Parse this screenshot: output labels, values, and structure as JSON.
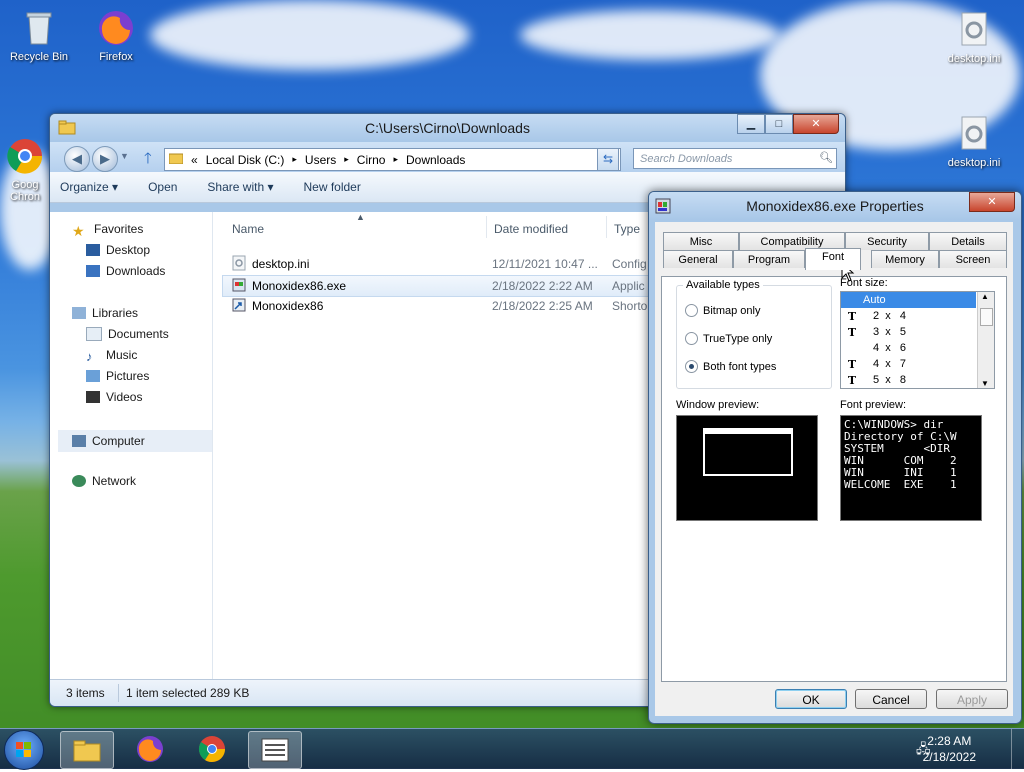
{
  "desktop": {
    "icons": {
      "recycle_bin": "Recycle Bin",
      "firefox": "Firefox",
      "chrome": "Goog\nChron",
      "desktop_ini_1": "desktop.ini",
      "desktop_ini_2": "desktop.ini"
    }
  },
  "explorer": {
    "title": "C:\\Users\\Cirno\\Downloads",
    "address": {
      "prefix": "«",
      "crumbs": [
        "Local Disk (C:)",
        "Users",
        "Cirno",
        "Downloads"
      ],
      "sep": "▸"
    },
    "search_placeholder": "Search Downloads",
    "toolbar": {
      "organize": "Organize ▾",
      "open": "Open",
      "share_with": "Share with ▾",
      "new_folder": "New folder"
    },
    "nav": {
      "favorites": "Favorites",
      "desktop": "Desktop",
      "downloads": "Downloads",
      "libraries": "Libraries",
      "documents": "Documents",
      "music": "Music",
      "pictures": "Pictures",
      "videos": "Videos",
      "computer": "Computer",
      "network": "Network"
    },
    "columns": {
      "name": "Name",
      "date_modified": "Date modified",
      "type": "Type"
    },
    "files": [
      {
        "name": "desktop.ini",
        "date": "12/11/2021 10:47 ...",
        "type": "Config"
      },
      {
        "name": "Monoxidex86.exe",
        "date": "2/18/2022 2:22 AM",
        "type": "Applic"
      },
      {
        "name": "Monoxidex86",
        "date": "2/18/2022 2:25 AM",
        "type": "Shorto"
      }
    ],
    "status": {
      "count": "3 items",
      "selected": "1 item selected  289 KB"
    }
  },
  "properties": {
    "title": "Monoxidex86.exe Properties",
    "tabs_back": [
      "Misc",
      "Compatibility",
      "Security",
      "Details"
    ],
    "tabs_front": [
      "General",
      "Program",
      "Font",
      "Memory",
      "Screen"
    ],
    "available_types_label": "Available types",
    "radios": {
      "bitmap": "Bitmap only",
      "truetype": "TrueType only",
      "both": "Both font types"
    },
    "font_size_label": "Font size:",
    "font_sizes": [
      {
        "label": "Auto",
        "tt": ""
      },
      {
        "label": "2  x   4",
        "tt": "T"
      },
      {
        "label": "3  x   5",
        "tt": "T"
      },
      {
        "label": "4  x   6",
        "tt": ""
      },
      {
        "label": "4  x   7",
        "tt": "T"
      },
      {
        "label": "5  x   8",
        "tt": "T"
      }
    ],
    "window_preview_label": "Window preview:",
    "font_preview_label": "Font preview:",
    "font_preview_text": "C:\\WINDOWS> dir\nDirectory of C:\\W\nSYSTEM      <DIR\nWIN      COM    2\nWIN      INI    1\nWELCOME  EXE    1",
    "buttons": {
      "ok": "OK",
      "cancel": "Cancel",
      "apply": "Apply"
    }
  },
  "taskbar": {
    "time": "2:28 AM",
    "date": "2/18/2022"
  }
}
